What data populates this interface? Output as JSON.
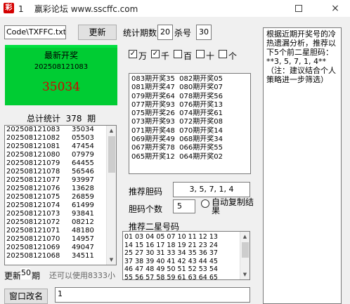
{
  "window": {
    "title": "1    赢彩论坛 www.sscffc.com",
    "icon_text": "彩",
    "restore_icon": "restore-icon",
    "close_icon": "×"
  },
  "controls": {
    "file_value": "Code\\TXFFC.txt",
    "update_button": "更新",
    "stats_periods_label": "统计期数",
    "stats_periods_value": "20",
    "kill_label": "杀号",
    "kill_value": "30"
  },
  "latest": {
    "label": "最新开奖",
    "period": "202508121083",
    "number": "35034"
  },
  "total": {
    "label": "总计统计  378  期"
  },
  "history": [
    {
      "period": "202508121083",
      "number": "35034"
    },
    {
      "period": "202508121082",
      "number": "05503"
    },
    {
      "period": "202508121081",
      "number": "47454"
    },
    {
      "period": "202508121080",
      "number": "07979"
    },
    {
      "period": "202508121079",
      "number": "64455"
    },
    {
      "period": "202508121078",
      "number": "56546"
    },
    {
      "period": "202508121077",
      "number": "93997"
    },
    {
      "period": "202508121076",
      "number": "13628"
    },
    {
      "period": "202508121075",
      "number": "26859"
    },
    {
      "period": "202508121074",
      "number": "61499"
    },
    {
      "period": "202508121073",
      "number": "93841"
    },
    {
      "period": "202508121072",
      "number": "08212"
    },
    {
      "period": "202508121071",
      "number": "48180"
    },
    {
      "period": "202508121070",
      "number": "14957"
    },
    {
      "period": "202508121069",
      "number": "49047"
    },
    {
      "period": "202508121068",
      "number": "34511"
    }
  ],
  "footer": {
    "update_label": "更新",
    "update_n": "50",
    "update_suffix": "期",
    "remaining_text": "还可以使用8333小",
    "rename_button": "窗口改名",
    "bottom_input": "1"
  },
  "positions": [
    {
      "label": "万",
      "checked": true
    },
    {
      "label": "千",
      "checked": true
    },
    {
      "label": "百",
      "checked": false
    },
    {
      "label": "十",
      "checked": false
    },
    {
      "label": "个",
      "checked": false
    }
  ],
  "combos": [
    "083期开奖35  082期开奖05",
    "081期开奖47  080期开奖07",
    "079期开奖64  078期开奖56",
    "077期开奖93  076期开奖13",
    "075期开奖26  074期开奖61",
    "073期开奖93  072期开奖08",
    "071期开奖48  070期开奖14",
    "069期开奖49  068期开奖34",
    "067期开奖78  066期开奖55",
    "065期开奖12  064期开奖02"
  ],
  "recommend": {
    "label": "推荐胆码",
    "value": "3, 5, 7, 1, 4",
    "count_label": "胆码个数",
    "count_value": "5",
    "auto_copy_label": "自动复制结果",
    "two_star_label": "推荐二星号码"
  },
  "two_star": [
    "01 03 04 05 07 10 11 12 13",
    "14 15 16 17 18 19 21 23 24",
    "25 27 30 31 33 34 35 36 37",
    "37 38 39 40 41 42 43 44 45",
    "46 47 48 49 50 51 52 53 54",
    "55 56 57 58 59 61 63 64 65"
  ],
  "info": {
    "text": "根据近期开奖号的冷热遗漏分析，推荐以下5个前二星胆码：   **3, 5, 7, 1, 4**（注：建议结合个人策略进一步筛选）"
  }
}
